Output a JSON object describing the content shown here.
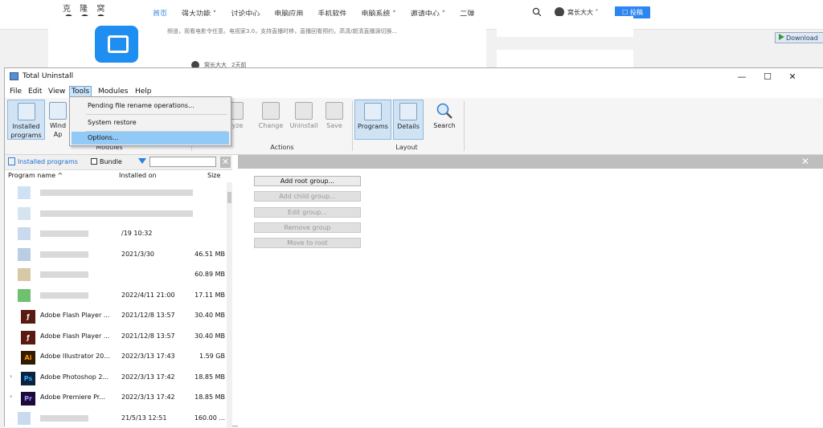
{
  "site": {
    "logo_text": "克 隆 窝",
    "nav": [
      "首页",
      "强大功能 ˅",
      "讨论中心",
      "电脑应用",
      "手机软件",
      "电脑系统 ˅",
      "邀请中心 ˅",
      "二弹"
    ],
    "user_name": "窝长大大 ˅",
    "post_button": "☐ 投稿",
    "card_snippet": "频道，观看电影令任意。电视家3.0，支持直播时移，直播回看预约，高清/超清直播源切换...",
    "card_author": "窝长大大",
    "card_time": "2天前",
    "download_button": "Download"
  },
  "window": {
    "title": "Total Uninstall",
    "controls": [
      "—",
      "☐",
      "✕"
    ],
    "menu": [
      "File",
      "Edit",
      "View",
      "Tools",
      "Modules",
      "Help"
    ]
  },
  "ribbon": {
    "installed_programs": "Installed programs",
    "windows_apps": "Wind Ap",
    "analyze": "alyze",
    "change": "Change",
    "uninstall": "Uninstall",
    "save": "Save",
    "programs": "Programs",
    "details": "Details",
    "search": "Search",
    "group_modules": "Modules",
    "group_actions": "Actions",
    "group_layout": "Layout"
  },
  "tools_menu": {
    "items": [
      "Pending file rename operations...",
      "System restore",
      "Options..."
    ]
  },
  "left_pane": {
    "title": "Installed programs",
    "bundle_label": "Bundle",
    "columns": {
      "name": "Program name ^",
      "installed": "Installed on",
      "size": "Size"
    },
    "rows": [
      {
        "name": "",
        "date": "",
        "size": "",
        "icon_color": "#cfe2f3"
      },
      {
        "name": "",
        "date": "",
        "size": "",
        "icon_color": "#d6e4f0"
      },
      {
        "name": "",
        "date": "/19 10:32",
        "size": "",
        "icon_color": "#c9d9ee"
      },
      {
        "name": "",
        "date": "2021/3/30",
        "size": "46.51 MB",
        "icon_color": "#b9cde3"
      },
      {
        "name": "",
        "date": "",
        "size": "60.89 MB",
        "icon_color": "#d7c9a8"
      },
      {
        "name": "",
        "date": "2022/4/11 21:00",
        "size": "17.11 MB",
        "icon_color": "#6fc06f"
      },
      {
        "name": "Adobe Flash Player ...",
        "date": "2021/12/8 13:57",
        "size": "30.40 MB",
        "icon_color": "#5a1a12",
        "icon_text": "ƒ"
      },
      {
        "name": "Adobe Flash Player ...",
        "date": "2021/12/8 13:57",
        "size": "30.40 MB",
        "icon_color": "#5a1a12",
        "icon_text": "ƒ"
      },
      {
        "name": "Adobe Illustrator 20...",
        "date": "2022/3/13 17:43",
        "size": "1.59 GB",
        "icon_color": "#331a00",
        "icon_text": "Ai"
      },
      {
        "name": "Adobe Photoshop 2...",
        "date": "2022/3/13 17:42",
        "size": "18.85 MB",
        "icon_color": "#0a2340",
        "icon_text": "Ps"
      },
      {
        "name": "Adobe Premiere Pr...",
        "date": "2022/3/13 17:42",
        "size": "18.85 MB",
        "icon_color": "#1e0a3a",
        "icon_text": "Pr"
      },
      {
        "name": "",
        "date": "21/5/13 12:51",
        "size": "160.00 ...",
        "icon_color": "#c9d9ee"
      }
    ]
  },
  "right_pane": {
    "buttons": [
      "Add root group...",
      "Add child group...",
      "Edit group...",
      "Remove group",
      "Move to root"
    ]
  }
}
